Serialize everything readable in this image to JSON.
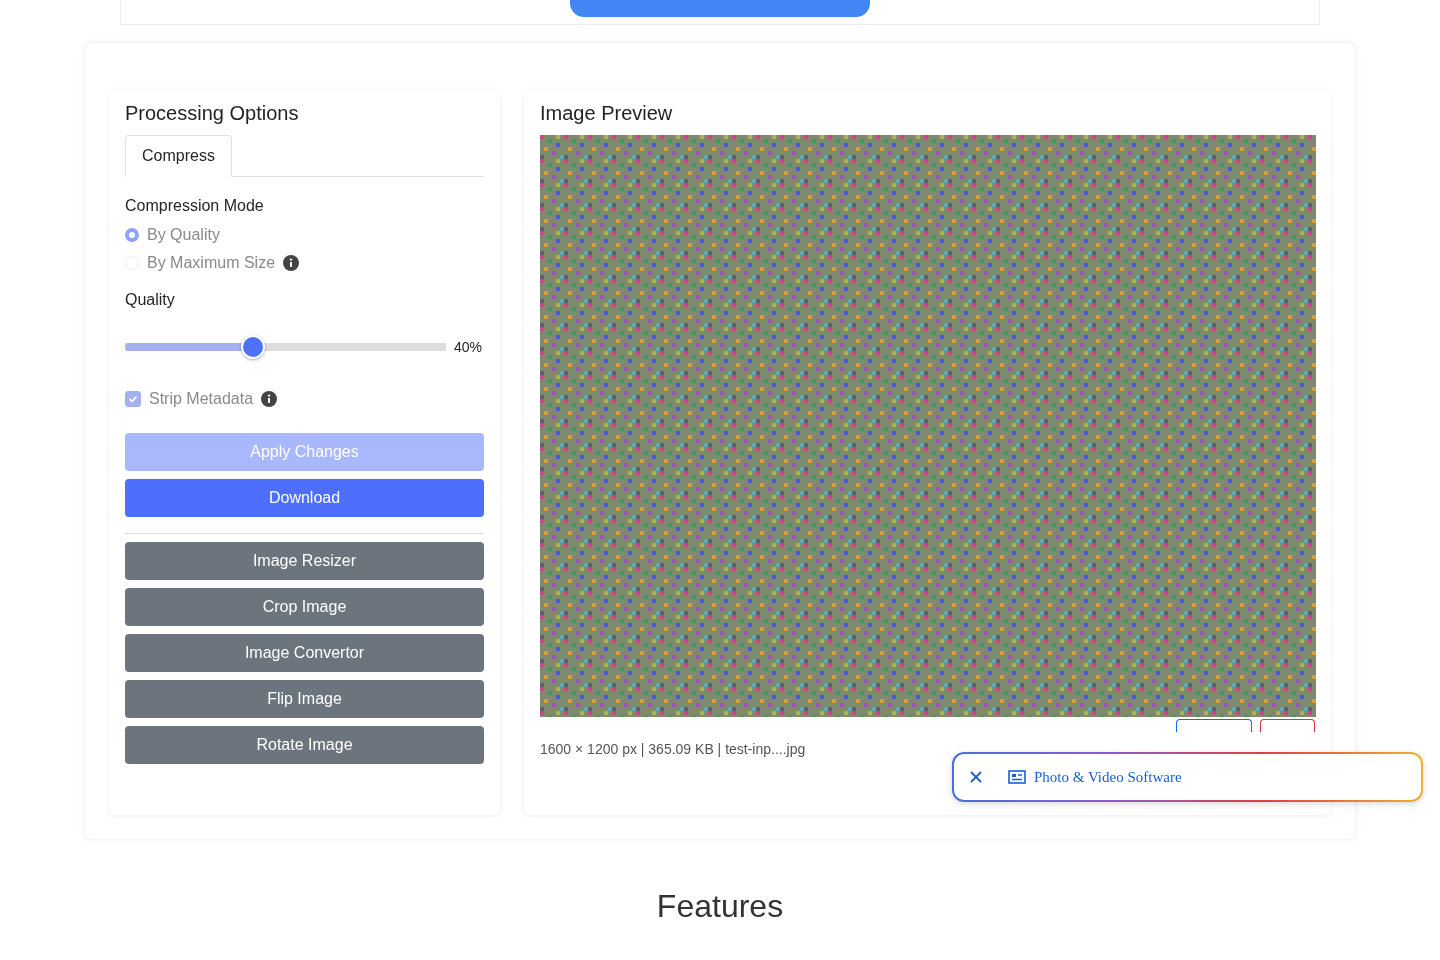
{
  "top_banner": {
    "kind": "button"
  },
  "options": {
    "title": "Processing Options",
    "tabs": [
      {
        "label": "Compress",
        "selected": true
      }
    ],
    "mode_label": "Compression Mode",
    "modes": [
      {
        "label": "By Quality",
        "selected": true,
        "info": false
      },
      {
        "label": "By Maximum Size",
        "selected": false,
        "info": true
      }
    ],
    "quality_label": "Quality",
    "quality": {
      "level": 0.4,
      "reading": "40%"
    },
    "strip_metadata": {
      "label": "Strip Metadata",
      "checked": true,
      "info": true
    },
    "actions": [
      {
        "label": "Apply Changes",
        "disabled": true
      },
      {
        "label": "Download",
        "disabled": false
      }
    ],
    "tools": [
      "Image Resizer",
      "Crop Image",
      "Image Convertor",
      "Flip Image",
      "Rotate Image"
    ]
  },
  "preview": {
    "title": "Image Preview",
    "info": "1600 × 1200 px | 365.09 KB | test-inp....jpg",
    "buttons": [
      {
        "kind": "outline-blue"
      },
      {
        "kind": "outline-red"
      }
    ]
  },
  "ad_bar": {
    "text": "Photo & Video Software"
  },
  "features": {
    "title": "Features"
  }
}
